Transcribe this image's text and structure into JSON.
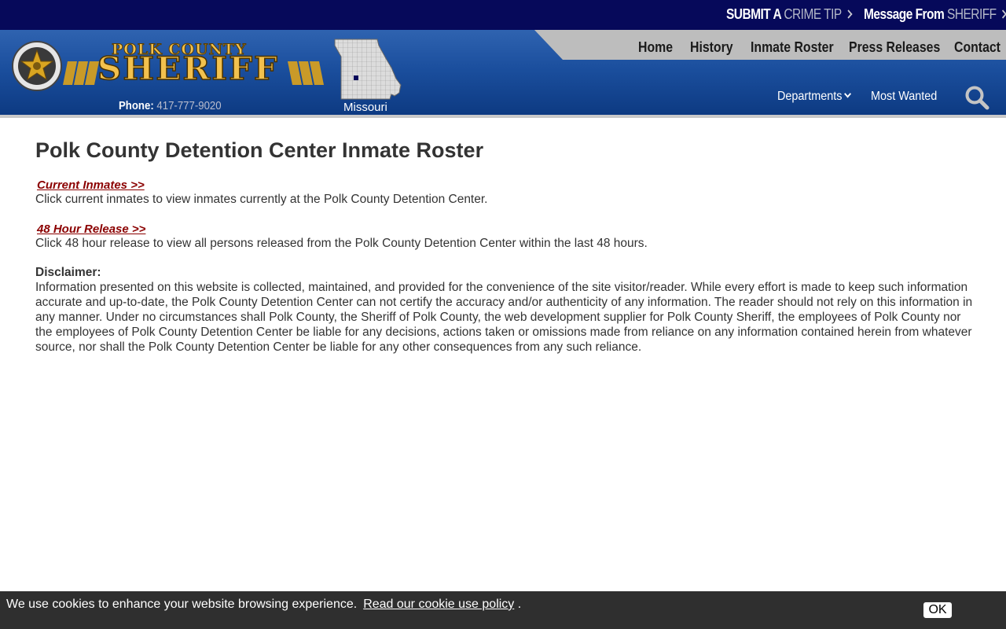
{
  "topbar": {
    "crime_tip": {
      "prefix": "SUBMIT A",
      "highlight": "CRIME TIP"
    },
    "sheriff_message": {
      "prefix": "Message From",
      "highlight": "SHERIFF"
    }
  },
  "header": {
    "logo_top": "POLK COUNTY",
    "logo_main": "SHERIFF",
    "phone_label": "Phone:",
    "phone_number": "417-777-9020",
    "state_label": "Missouri"
  },
  "nav": {
    "items": [
      "Home",
      "History",
      "Inmate Roster",
      "Press Releases",
      "Contact"
    ],
    "departments": "Departments",
    "most_wanted": "Most Wanted"
  },
  "main": {
    "title": "Polk County Detention Center Inmate Roster",
    "current_link": "Current Inmates >>",
    "current_desc": "Click current inmates to view inmates currently at the Polk County Detention Center.",
    "release_link": "48 Hour Release >>",
    "release_desc": "Click 48 hour release to view all persons released from the Polk County Detention Center within the last 48 hours.",
    "disclaimer_title": "Disclaimer:",
    "disclaimer_text": "Information presented on this website is collected, maintained, and provided for the convenience of the site visitor/reader. While every effort is made to keep such information accurate and up-to-date, the Polk County Detention Center can not certify the accuracy and/or authenticity of any information. The reader should not rely on this information in any manner.  Under no circumstances shall Polk County, the Sheriff of Polk County, the web development supplier for Polk County Sheriff, the employees of Polk County nor the employees of Polk County Detention Center be liable for any decisions, actions taken or omissions made from reliance on any information contained herein from whatever source, nor shall the Polk County Detention Center be liable for any other consequences from any such reliance."
  },
  "cookie": {
    "text": "We use cookies to enhance your website browsing experience.",
    "link": "Read our cookie use policy",
    "suffix": ".",
    "ok": "OK"
  },
  "icons": {
    "search": "search-icon",
    "badge": "sheriff-badge-icon",
    "map": "missouri-map-icon"
  },
  "colors": {
    "topbar": "#06095a",
    "header": "#1b4f9e",
    "link": "#8b0000",
    "cookie_bar": "#2f2f2f"
  }
}
